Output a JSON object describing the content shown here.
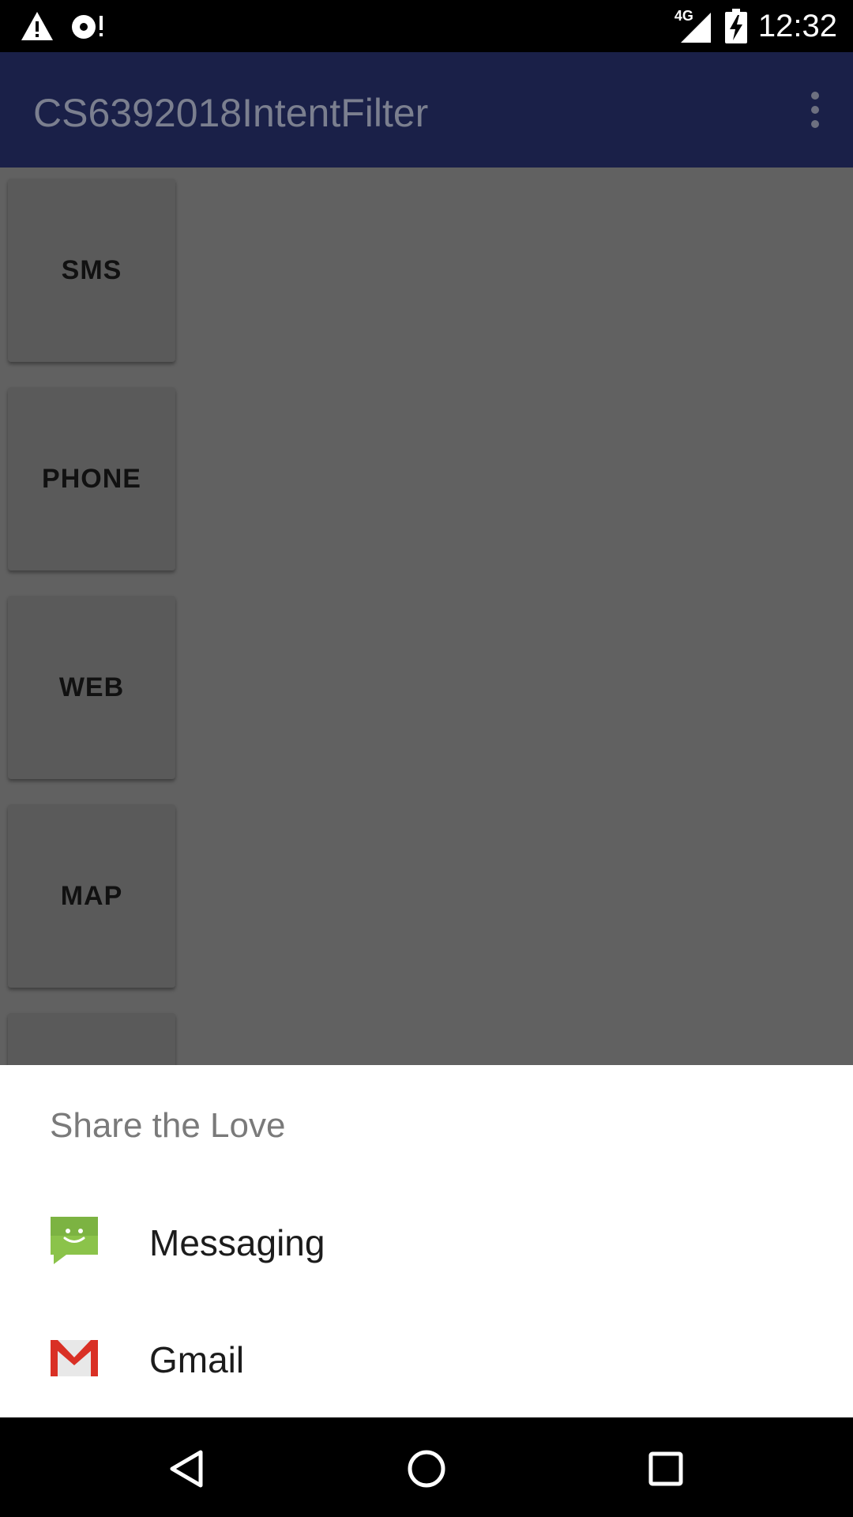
{
  "status_bar": {
    "time": "12:32",
    "network": "4G",
    "icons": [
      "warning-icon",
      "debug-icon",
      "signal-icon",
      "battery-charging-icon"
    ]
  },
  "app_bar": {
    "title": "CS6392018IntentFilter",
    "menu_icon": "more-vert-icon"
  },
  "buttons": [
    {
      "label": "SMS"
    },
    {
      "label": "PHONE"
    },
    {
      "label": "WEB"
    },
    {
      "label": "MAP"
    },
    {
      "label": ""
    }
  ],
  "share_sheet": {
    "title": "Share the Love",
    "items": [
      {
        "label": "Messaging",
        "icon": "messaging-icon",
        "color": "#8bc34a"
      },
      {
        "label": "Gmail",
        "icon": "gmail-icon",
        "color": "#d93025"
      }
    ]
  },
  "nav_bar": {
    "buttons": [
      "back-icon",
      "home-icon",
      "recents-icon"
    ]
  }
}
